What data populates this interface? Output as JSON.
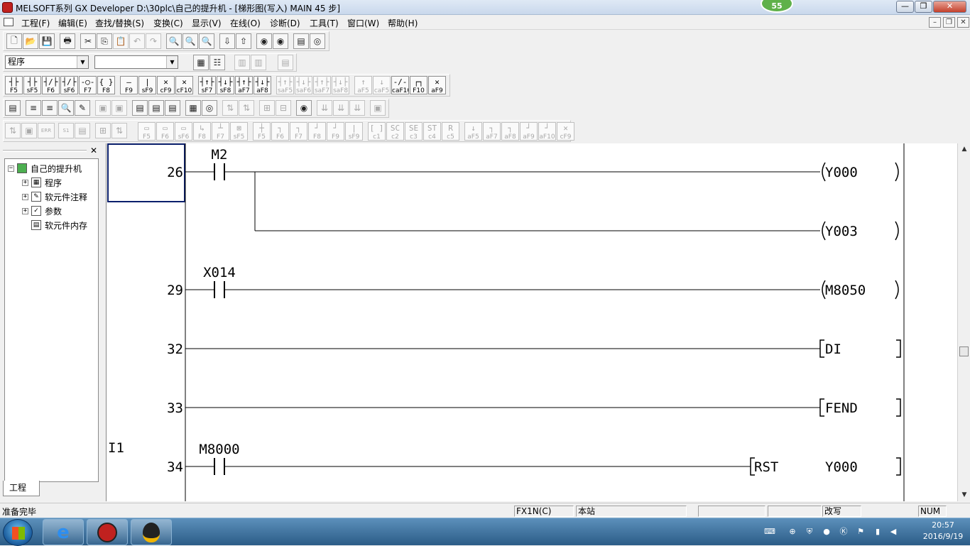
{
  "window": {
    "title": "MELSOFT系列 GX Developer D:\\30plc\\自己的提升机 - [梯形图(写入)     MAIN    45 步]",
    "badge": "55"
  },
  "menu": [
    "工程(F)",
    "编辑(E)",
    "查找/替换(S)",
    "变换(C)",
    "显示(V)",
    "在线(O)",
    "诊断(D)",
    "工具(T)",
    "窗口(W)",
    "帮助(H)"
  ],
  "toolbar": {
    "data_type_select": "程序",
    "device_select": ""
  },
  "ladder_keys": [
    {
      "sym": "┤├",
      "key": "F5"
    },
    {
      "sym": "┤├",
      "key": "sF5"
    },
    {
      "sym": "┤/├",
      "key": "F6"
    },
    {
      "sym": "┤/├",
      "key": "sF6"
    },
    {
      "sym": "-○-",
      "key": "F7"
    },
    {
      "sym": "{ }",
      "key": "F8"
    },
    {
      "sym": "—",
      "key": "F9"
    },
    {
      "sym": "|",
      "key": "sF9"
    },
    {
      "sym": "✕",
      "key": "cF9"
    },
    {
      "sym": "✕",
      "key": "cF10"
    },
    {
      "sym": "┤↑├",
      "key": "sF7"
    },
    {
      "sym": "┤↓├",
      "key": "sF8"
    },
    {
      "sym": "┤↑├",
      "key": "aF7"
    },
    {
      "sym": "┤↓├",
      "key": "aF8"
    },
    {
      "sym": "┤↑├",
      "key": "saF5"
    },
    {
      "sym": "┤↓├",
      "key": "saF6"
    },
    {
      "sym": "┤↑├",
      "key": "saF7"
    },
    {
      "sym": "┤↓├",
      "key": "saF8"
    },
    {
      "sym": "↑",
      "key": "aF5"
    },
    {
      "sym": "↓",
      "key": "caF5"
    },
    {
      "sym": "-/-",
      "key": "caF10"
    },
    {
      "sym": "┌┐",
      "key": "F10"
    },
    {
      "sym": "✕",
      "key": "aF9"
    }
  ],
  "device_keys": [
    {
      "sym": "▭",
      "key": "F5"
    },
    {
      "sym": "▭",
      "key": "F6"
    },
    {
      "sym": "▭",
      "key": "sF6"
    },
    {
      "sym": "↳",
      "key": "F8"
    },
    {
      "sym": "┴",
      "key": "F7"
    },
    {
      "sym": "⊠",
      "key": "sF5"
    },
    {
      "sym": "┼",
      "key": "F5"
    },
    {
      "sym": "┐",
      "key": "F6"
    },
    {
      "sym": "┐",
      "key": "F7"
    },
    {
      "sym": "┘",
      "key": "F8"
    },
    {
      "sym": "┘",
      "key": "F9"
    },
    {
      "sym": "|",
      "key": "sF9"
    },
    {
      "sym": "[ ]",
      "key": "c1"
    },
    {
      "sym": "SC",
      "key": "c2"
    },
    {
      "sym": "SE",
      "key": "c3"
    },
    {
      "sym": "ST",
      "key": "c4"
    },
    {
      "sym": "R",
      "key": "c5"
    },
    {
      "sym": "↓",
      "key": "aF5"
    },
    {
      "sym": "┐",
      "key": "aF7"
    },
    {
      "sym": "┐",
      "key": "aF8"
    },
    {
      "sym": "┘",
      "key": "aF9"
    },
    {
      "sym": "┘",
      "key": "aF10"
    },
    {
      "sym": "✕",
      "key": "cF9"
    }
  ],
  "project_tree": {
    "root": "自己的提升机",
    "items": [
      "程序",
      "软元件注释",
      "参数",
      "软元件内存"
    ],
    "tab": "工程"
  },
  "ladder": {
    "rungs": [
      {
        "step": "26",
        "contact": "M2",
        "coils": [
          "Y000",
          "Y003"
        ]
      },
      {
        "step": "29",
        "contact": "X014",
        "coils": [
          "M8050"
        ]
      },
      {
        "step": "32",
        "contact": "",
        "coils": [
          "DI"
        ]
      },
      {
        "step": "33",
        "contact": "",
        "coils": [
          "FEND"
        ]
      },
      {
        "step": "34",
        "pointer": "I1",
        "contact": "M8000",
        "instr": "RST",
        "operand": "Y000"
      }
    ]
  },
  "statusbar": {
    "message": "准备完毕",
    "plc_type": "FX1N(C)",
    "station": "本站",
    "mode": "改写",
    "num": "NUM"
  },
  "clock": {
    "time": "20:57",
    "date": "2016/9/19"
  }
}
